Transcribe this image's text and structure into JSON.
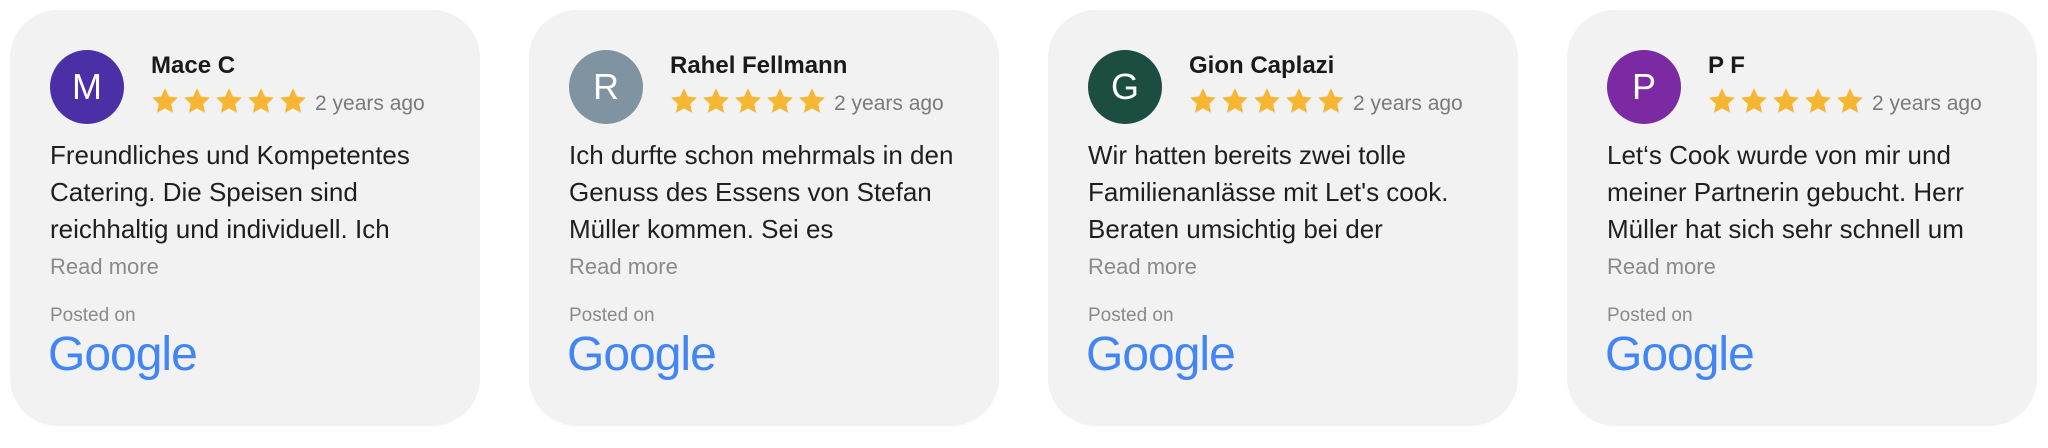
{
  "colors": {
    "card_background": "#f2f2f2",
    "star": "#f5b731",
    "google_blue": "#4285f4",
    "muted_text": "#8a8a8a"
  },
  "reviews": [
    {
      "avatar_letter": "M",
      "avatar_color": "#4a2fa6",
      "name": "Mace C",
      "rating": 5,
      "time": "2 years ago",
      "text": "Freundliches und Kompetentes Catering. Die Speisen sind reichhaltig und individuell. Ich",
      "read_more": "Read more",
      "posted_on": "Posted on",
      "platform": "Google"
    },
    {
      "avatar_letter": "R",
      "avatar_color": "#7f93a0",
      "name": "Rahel Fellmann",
      "rating": 5,
      "time": "2 years ago",
      "text": "Ich durfte schon mehrmals in den Genuss des Essens von Stefan Müller kommen. Sei es",
      "read_more": "Read more",
      "posted_on": "Posted on",
      "platform": "Google"
    },
    {
      "avatar_letter": "G",
      "avatar_color": "#1b4d40",
      "name": "Gion Caplazi",
      "rating": 5,
      "time": "2 years ago",
      "text": "Wir hatten bereits zwei tolle Familienanlässe mit Let's cook. Beraten umsichtig bei der",
      "read_more": "Read more",
      "posted_on": "Posted on",
      "platform": "Google"
    },
    {
      "avatar_letter": "P",
      "avatar_color": "#7b2aa3",
      "name": "P F",
      "rating": 5,
      "time": "2 years ago",
      "text": "Let‘s Cook wurde von mir und meiner Partnerin gebucht. Herr Müller hat sich sehr schnell um",
      "read_more": "Read more",
      "posted_on": "Posted on",
      "platform": "Google"
    }
  ]
}
